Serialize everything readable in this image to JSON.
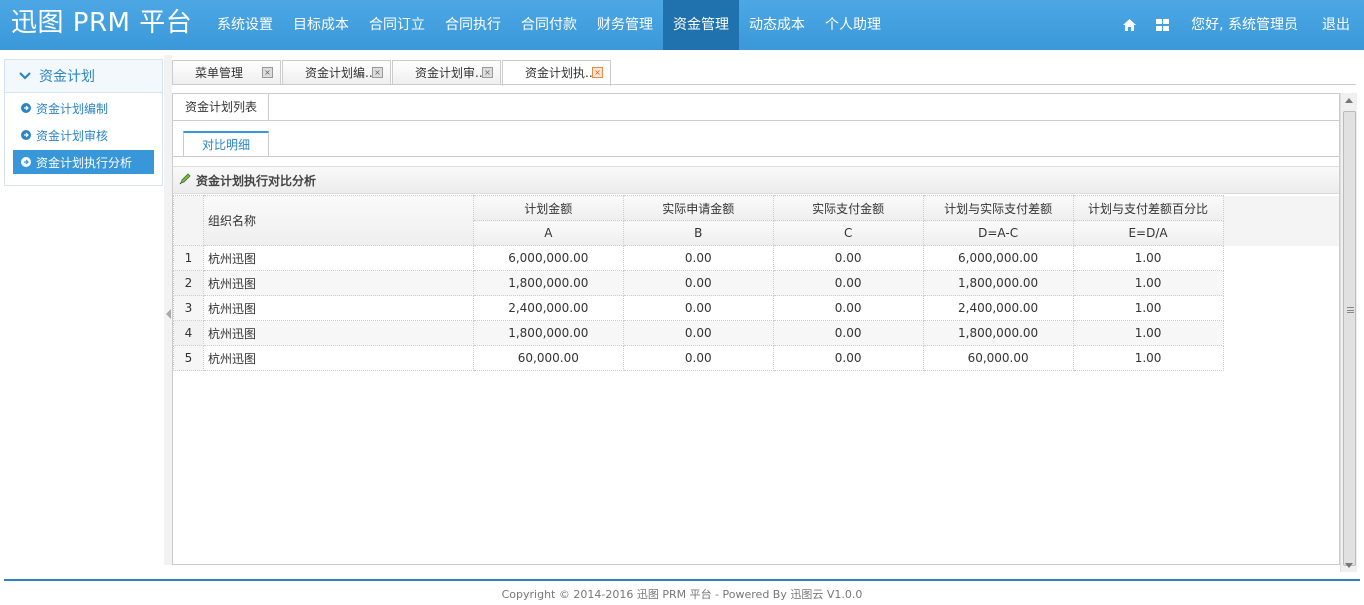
{
  "app": {
    "brand": "迅图 PRM 平台"
  },
  "nav": {
    "items": [
      "系统设置",
      "目标成本",
      "合同订立",
      "合同执行",
      "合同付款",
      "财务管理",
      "资金管理",
      "动态成本",
      "个人助理"
    ],
    "active_index": 6
  },
  "topbar": {
    "greeting": "您好, 系统管理员",
    "logout": "退出",
    "home_icon": "home-icon",
    "grid_icon": "apps-icon"
  },
  "sidebar": {
    "title": "资金计划",
    "items": [
      "资金计划编制",
      "资金计划审核",
      "资金计划执行分析"
    ],
    "active_index": 2
  },
  "tabs": [
    "菜单管理",
    "资金计划编...",
    "资金计划审...",
    "资金计划执..."
  ],
  "active_tab": 3,
  "panel": {
    "tab": "资金计划列表",
    "inner_tab": "对比明细",
    "grid_title": "资金计划执行对比分析"
  },
  "grid": {
    "headers": {
      "name": "组织名称",
      "cols": [
        "计划金额",
        "实际申请金额",
        "实际支付金额",
        "计划与实际支付差额",
        "计划与支付差额百分比"
      ],
      "codes": [
        "A",
        "B",
        "C",
        "D=A-C",
        "E=D/A"
      ]
    },
    "rows": [
      {
        "no": "1",
        "name": "杭州迅图",
        "a": "6,000,000.00",
        "b": "0.00",
        "c": "0.00",
        "d": "6,000,000.00",
        "e": "1.00"
      },
      {
        "no": "2",
        "name": "杭州迅图",
        "a": "1,800,000.00",
        "b": "0.00",
        "c": "0.00",
        "d": "1,800,000.00",
        "e": "1.00"
      },
      {
        "no": "3",
        "name": "杭州迅图",
        "a": "2,400,000.00",
        "b": "0.00",
        "c": "0.00",
        "d": "2,400,000.00",
        "e": "1.00"
      },
      {
        "no": "4",
        "name": "杭州迅图",
        "a": "1,800,000.00",
        "b": "0.00",
        "c": "0.00",
        "d": "1,800,000.00",
        "e": "1.00"
      },
      {
        "no": "5",
        "name": "杭州迅图",
        "a": "60,000.00",
        "b": "0.00",
        "c": "0.00",
        "d": "60,000.00",
        "e": "1.00"
      }
    ]
  },
  "footer": "Copyright © 2014-2016 迅图 PRM 平台 - Powered By 迅图云 V1.0.0",
  "colors": {
    "primary": "#3b98d9",
    "active_nav": "#1f72ad",
    "link": "#2b84c7"
  }
}
